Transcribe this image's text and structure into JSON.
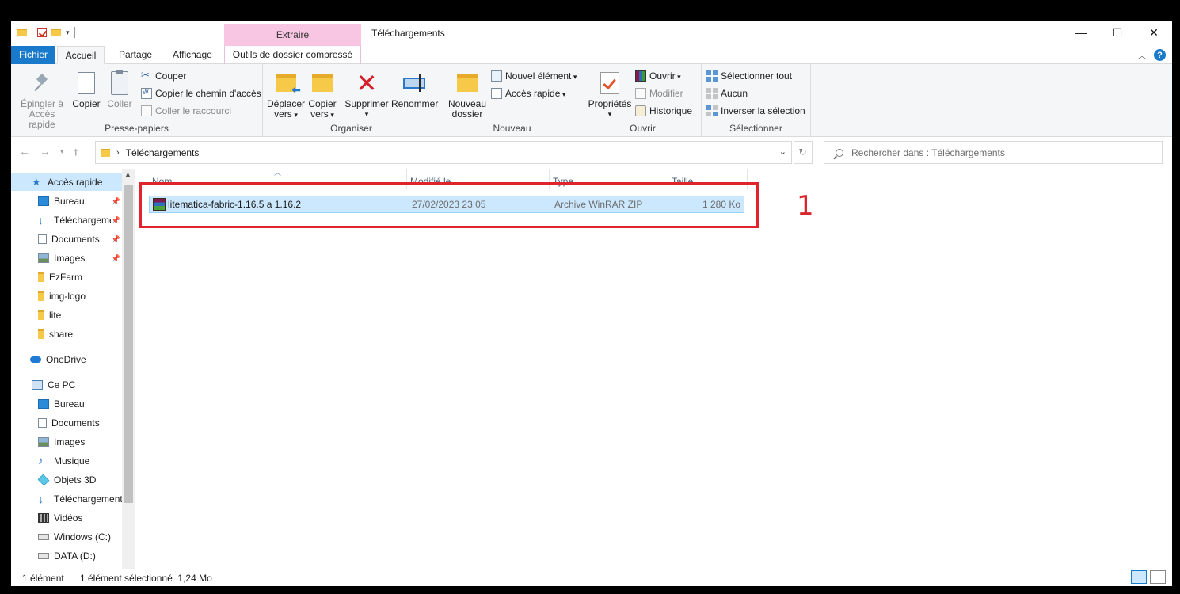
{
  "window": {
    "title": "Téléchargements",
    "context_tab_top": "Extraire",
    "controls": [
      "minimize",
      "maximize",
      "close"
    ]
  },
  "tabs": {
    "file": "Fichier",
    "home": "Accueil",
    "share": "Partage",
    "view": "Affichage",
    "context": "Outils de dossier compressé"
  },
  "ribbon": {
    "clipboard": {
      "label": "Presse-papiers",
      "pin_line1": "Épingler à",
      "pin_line2": "Accès rapide",
      "copy": "Copier",
      "paste": "Coller",
      "cut": "Couper",
      "copy_path": "Copier le chemin d'accès",
      "paste_shortcut": "Coller le raccourci"
    },
    "organize": {
      "label": "Organiser",
      "move_line1": "Déplacer",
      "move_line2": "vers",
      "copy_line1": "Copier",
      "copy_line2": "vers",
      "delete": "Supprimer",
      "rename": "Renommer"
    },
    "new": {
      "label": "Nouveau",
      "new_folder_line1": "Nouveau",
      "new_folder_line2": "dossier",
      "new_item": "Nouvel élément",
      "quick_access": "Accès rapide"
    },
    "open": {
      "label": "Ouvrir",
      "properties": "Propriétés",
      "open": "Ouvrir",
      "edit": "Modifier",
      "history": "Historique"
    },
    "select": {
      "label": "Sélectionner",
      "select_all": "Sélectionner tout",
      "select_none": "Aucun",
      "invert": "Inverser la sélection"
    }
  },
  "address": {
    "crumb": "Téléchargements",
    "search_placeholder": "Rechercher dans : Téléchargements"
  },
  "navpane": {
    "items": [
      {
        "label": "Accès rapide",
        "icon": "star-icon"
      },
      {
        "label": "Bureau",
        "icon": "desktop-icon"
      },
      {
        "label": "Téléchargements",
        "icon": "download-icon"
      },
      {
        "label": "Documents",
        "icon": "documents-icon"
      },
      {
        "label": "Images",
        "icon": "images-icon"
      },
      {
        "label": "EzFarm",
        "icon": "folder-icon"
      },
      {
        "label": "img-logo",
        "icon": "folder-icon"
      },
      {
        "label": "lite",
        "icon": "folder-icon"
      },
      {
        "label": "share",
        "icon": "folder-icon"
      },
      {
        "label": "OneDrive",
        "icon": "cloud-icon"
      },
      {
        "label": "Ce PC",
        "icon": "pc-icon"
      },
      {
        "label": "Bureau",
        "icon": "desktop-icon"
      },
      {
        "label": "Documents",
        "icon": "documents-icon"
      },
      {
        "label": "Images",
        "icon": "images-icon"
      },
      {
        "label": "Musique",
        "icon": "music-icon"
      },
      {
        "label": "Objets 3D",
        "icon": "objects3d-icon"
      },
      {
        "label": "Téléchargements",
        "icon": "download-icon"
      },
      {
        "label": "Vidéos",
        "icon": "video-icon"
      },
      {
        "label": "Windows (C:)",
        "icon": "drive-icon"
      },
      {
        "label": "DATA (D:)",
        "icon": "drive-icon"
      }
    ]
  },
  "filelist": {
    "columns": [
      "Nom",
      "Modifié le",
      "Type",
      "Taille"
    ],
    "rows": [
      {
        "name": "litematica-fabric-1.16.5 a 1.16.2",
        "modified": "27/02/2023 23:05",
        "type": "Archive WinRAR ZIP",
        "size": "1 280 Ko"
      }
    ]
  },
  "annotation": {
    "number": "1",
    "color": "#e0242b"
  },
  "status": {
    "count": "1 élément",
    "selection": "1 élément sélectionné  1,24 Mo"
  },
  "colors": {
    "accent": "#1979ca",
    "selection": "#cce8ff",
    "context_tab": "#f8c6e3"
  }
}
